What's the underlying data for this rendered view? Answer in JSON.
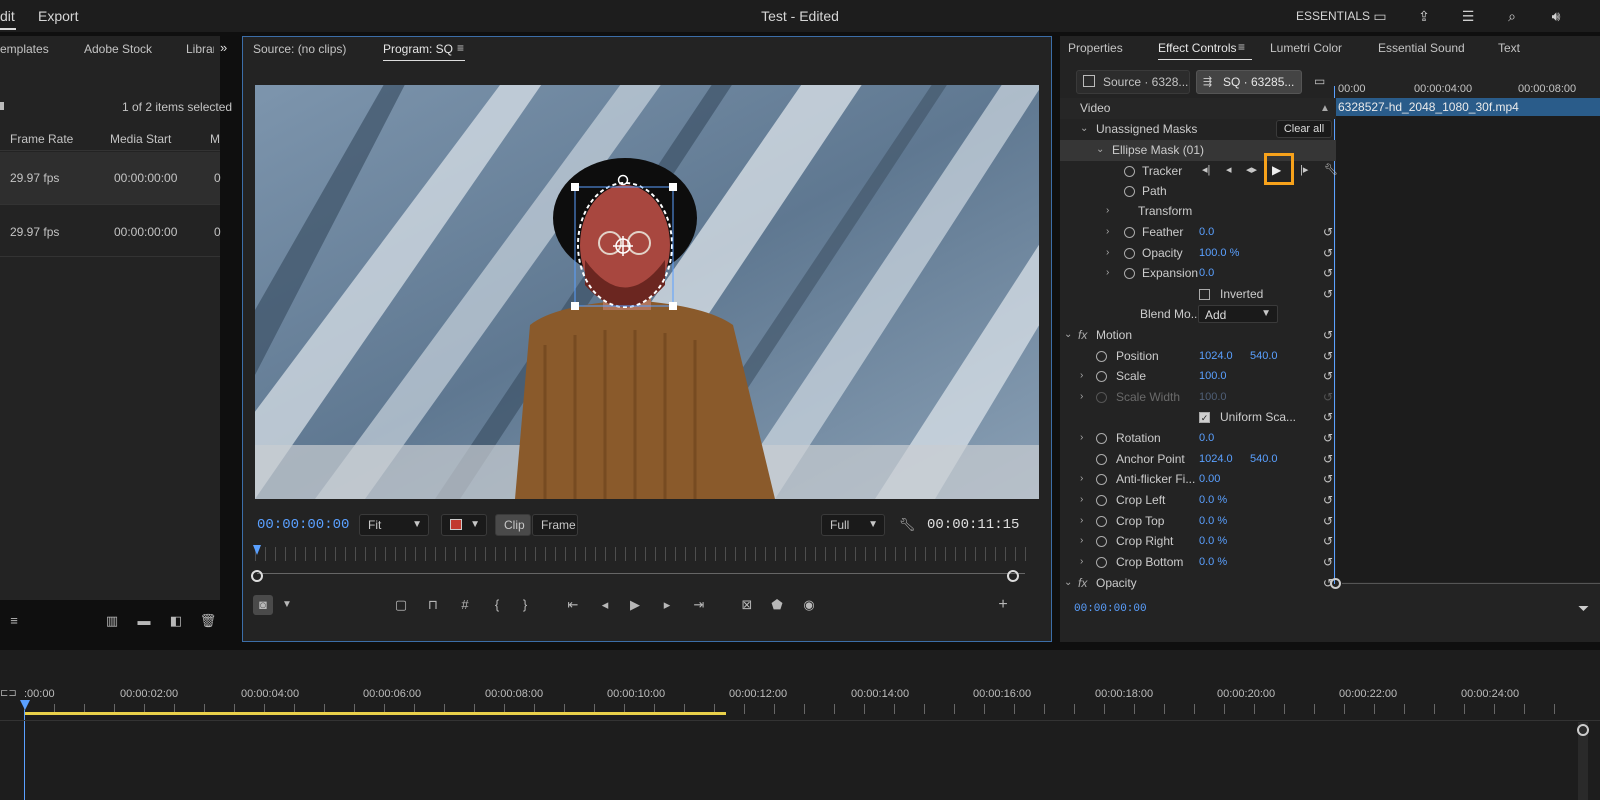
{
  "topbar": {
    "edit_tab": "dit",
    "export_tab": "Export",
    "title": "Test - Edited",
    "workspace": "ESSENTIALS"
  },
  "project": {
    "tabs": [
      "emplates",
      "Adobe Stock",
      "Librar"
    ],
    "selection_status": "1 of 2 items selected",
    "columns": [
      "Frame Rate",
      "Media Start",
      "M"
    ],
    "rows": [
      {
        "frame_rate": "29.97 fps",
        "media_start": "00:00:00:00",
        "m": "0"
      },
      {
        "frame_rate": "29.97 fps",
        "media_start": "00:00:00:00",
        "m": "0"
      }
    ]
  },
  "monitor": {
    "source_tab": "Source: (no clips)",
    "program_tab": "Program: SQ",
    "timecode_current": "00:00:00:00",
    "fit_value": "Fit",
    "clip_label": "Clip",
    "frame_label": "Frame",
    "resolution_value": "Full",
    "timecode_duration": "00:00:11:15"
  },
  "effects": {
    "tabs": [
      "Properties",
      "Effect Controls",
      "Lumetri Color",
      "Essential Sound",
      "Text"
    ],
    "source_chip": "Source · 6328...",
    "sequence_chip": "SQ · 63285...",
    "section_video": "Video",
    "unassigned_masks": "Unassigned Masks",
    "clear_all": "Clear all",
    "ellipse_mask": "Ellipse Mask (01)",
    "tracker": "Tracker",
    "path": "Path",
    "transform": "Transform",
    "feather": {
      "label": "Feather",
      "value": "0.0"
    },
    "mask_opacity": {
      "label": "Opacity",
      "value": "100.0 %"
    },
    "expansion": {
      "label": "Expansion",
      "value": "0.0"
    },
    "inverted": "Inverted",
    "blend_mode": {
      "label": "Blend Mo...",
      "value": "Add"
    },
    "motion": "Motion",
    "position": {
      "label": "Position",
      "x": "1024.0",
      "y": "540.0"
    },
    "scale": {
      "label": "Scale",
      "value": "100.0"
    },
    "scale_width": {
      "label": "Scale Width",
      "value": "100.0"
    },
    "uniform_scale": "Uniform Sca...",
    "rotation": {
      "label": "Rotation",
      "value": "0.0"
    },
    "anchor_point": {
      "label": "Anchor Point",
      "x": "1024.0",
      "y": "540.0"
    },
    "anti_flicker": {
      "label": "Anti-flicker Fi...",
      "value": "0.00"
    },
    "crop_left": {
      "label": "Crop Left",
      "value": "0.0 %"
    },
    "crop_top": {
      "label": "Crop Top",
      "value": "0.0 %"
    },
    "crop_right": {
      "label": "Crop Right",
      "value": "0.0 %"
    },
    "crop_bottom": {
      "label": "Crop Bottom",
      "value": "0.0 %"
    },
    "opacity_section": "Opacity",
    "ec_timeline": {
      "t0": "00:00",
      "t1": "00:00:04:00",
      "t2": "00:00:08:00",
      "clip_name": "6328527-hd_2048_1080_30f.mp4"
    },
    "footer_timecode": "00:00:00:00"
  },
  "timeline": {
    "ticks": [
      ":00:00",
      "00:00:02:00",
      "00:00:04:00",
      "00:00:06:00",
      "00:00:08:00",
      "00:00:10:00",
      "00:00:12:00",
      "00:00:14:00",
      "00:00:16:00",
      "00:00:18:00",
      "00:00:20:00",
      "00:00:22:00",
      "00:00:24:00"
    ]
  },
  "colors": {
    "accent_blue": "#5aa0ff",
    "highlight_orange": "#f7a21b",
    "panel_border": "#3c6ea8",
    "render_bar_yellow": "#e8d04a"
  }
}
